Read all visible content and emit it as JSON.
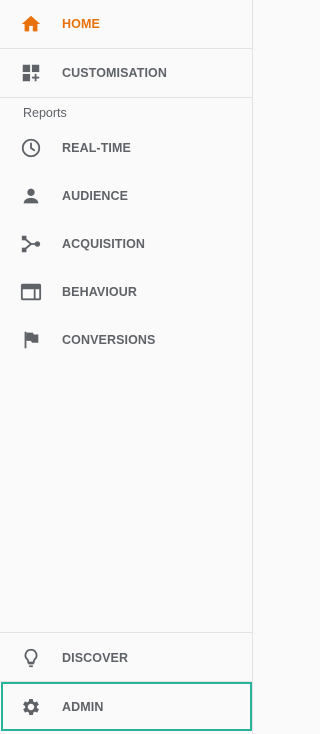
{
  "colors": {
    "accent": "#e8710a",
    "icon": "#5f6368",
    "text": "#5f6368",
    "highlight": "#2ab39b",
    "divider": "#e3e3e3",
    "background": "#fafafa"
  },
  "nav": {
    "home": {
      "label": "HOME",
      "icon": "home-icon",
      "active": true
    },
    "customisation": {
      "label": "CUSTOMISATION",
      "icon": "dashboard-plus-icon"
    }
  },
  "reports": {
    "header": "Reports",
    "items": [
      {
        "label": "REAL-TIME",
        "icon": "clock-icon"
      },
      {
        "label": "AUDIENCE",
        "icon": "person-icon"
      },
      {
        "label": "ACQUISITION",
        "icon": "branch-icon"
      },
      {
        "label": "BEHAVIOUR",
        "icon": "browser-window-icon"
      },
      {
        "label": "CONVERSIONS",
        "icon": "flag-icon"
      }
    ]
  },
  "footer": {
    "discover": {
      "label": "DISCOVER",
      "icon": "lightbulb-icon"
    },
    "admin": {
      "label": "ADMIN",
      "icon": "gear-icon",
      "highlighted": true
    }
  }
}
